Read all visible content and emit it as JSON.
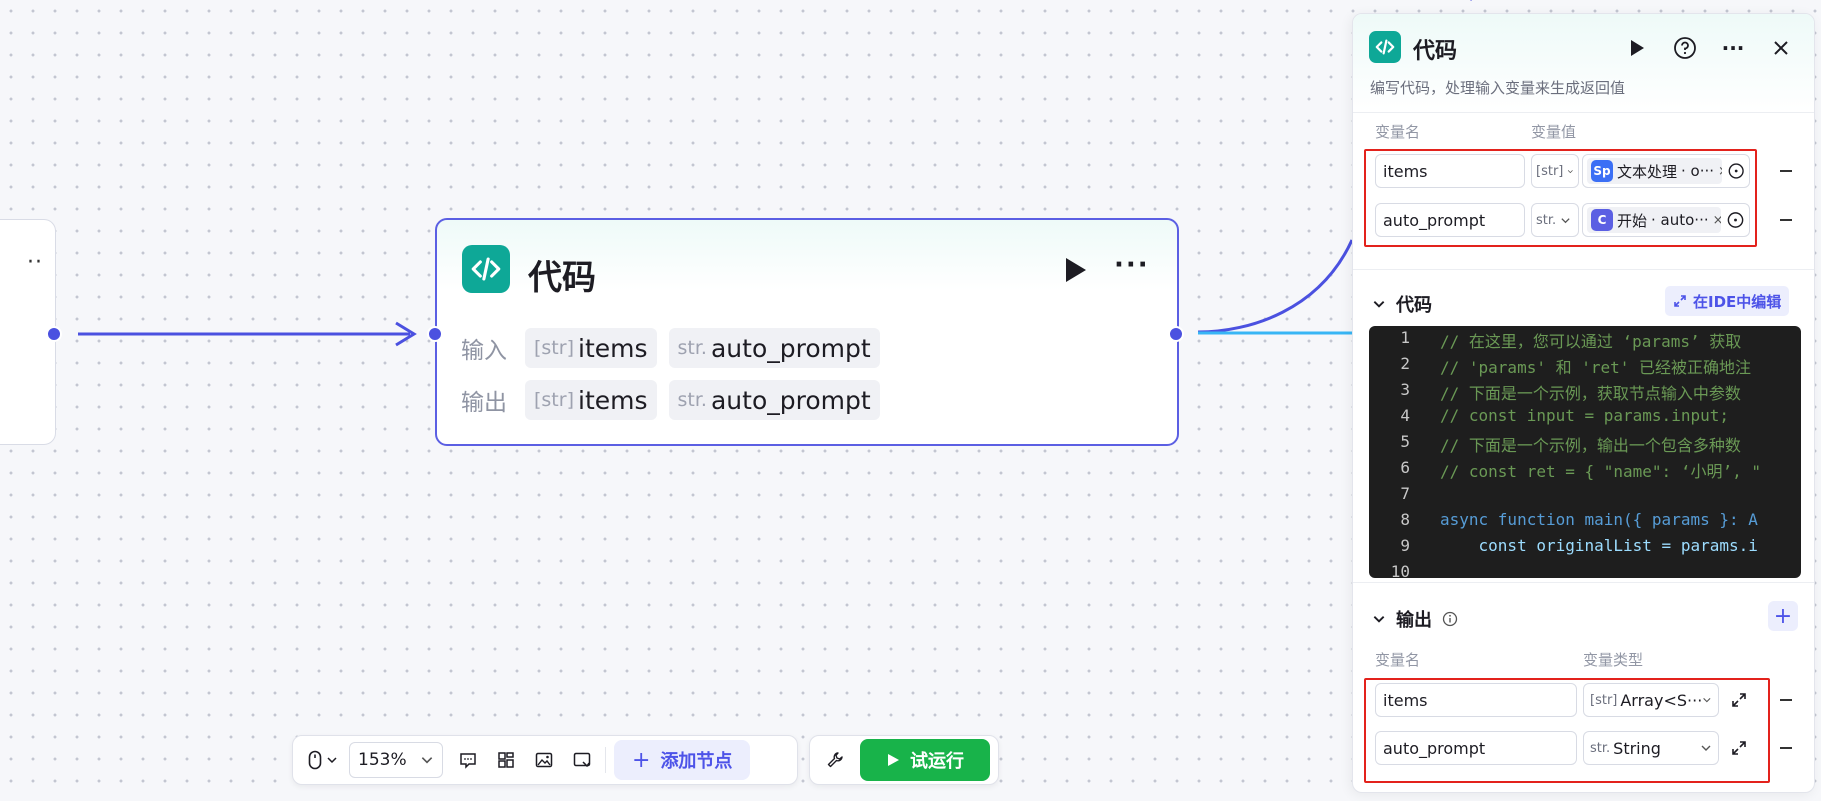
{
  "canvas": {
    "node": {
      "title": "代码",
      "input_label": "输入",
      "output_label": "输出",
      "inputs": [
        {
          "type": "[str]",
          "name": "items"
        },
        {
          "type": "str.",
          "name": "auto_prompt"
        }
      ],
      "outputs": [
        {
          "type": "[str]",
          "name": "items"
        },
        {
          "type": "str.",
          "name": "auto_prompt"
        }
      ]
    }
  },
  "toolbar": {
    "zoom": "153%",
    "add_node": "添加节点",
    "test_run": "试运行"
  },
  "panel": {
    "title": "代码",
    "description": "编写代码，处理输入变量来生成返回值",
    "input_section": {
      "col_name": "变量名",
      "col_value": "变量值",
      "rows": [
        {
          "name": "items",
          "type": "[str]",
          "ref_node": "文本处理",
          "ref_var": "· o···",
          "ref_icon_color": "#3b6ff5"
        },
        {
          "name": "auto_prompt",
          "type": "str.",
          "ref_node": "开始",
          "ref_var": "· auto···",
          "ref_icon_color": "#5b5fe3"
        }
      ]
    },
    "code_section": {
      "title": "代码",
      "ide_button": "在IDE中编辑",
      "line_numbers": [
        "1",
        "2",
        "3",
        "4",
        "5",
        "6",
        "7",
        "8",
        "9",
        "10"
      ],
      "lines": [
        "// 在这里，您可以通过 ‘params’ 获取",
        "// 'params' 和 'ret' 已经被正确地注",
        "// 下面是一个示例，获取节点输入中参数",
        "// const input = params.input;",
        "// 下面是一个示例，输出一个包含多种数",
        "// const ret = { \"name\": ‘小明’, \"",
        "",
        "async function main({ params }: A",
        "    const originalList = params.i",
        ""
      ]
    },
    "output_section": {
      "title": "输出",
      "col_name": "变量名",
      "col_type": "变量类型",
      "rows": [
        {
          "name": "items",
          "type_prefix": "[str]",
          "type": "Array<S···"
        },
        {
          "name": "auto_prompt",
          "type_prefix": "str.",
          "type": "String"
        }
      ]
    }
  },
  "colors": {
    "accent": "#4d53e8",
    "node_icon": "#0ea897",
    "run_green": "#18b34a",
    "highlight_red": "#e3221c"
  }
}
